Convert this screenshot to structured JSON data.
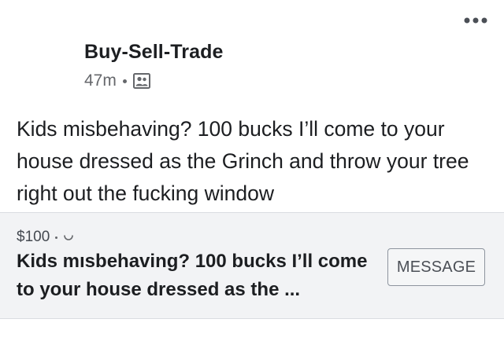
{
  "post": {
    "group_name": "Buy-Sell-Trade",
    "timestamp": "47m",
    "audience_icon": "group-members-icon",
    "more_icon": "more-options-icon",
    "text": "Kids misbehaving? 100 bucks I’ll come to your house dressed as the Grinch and throw your tree right out the fucking window"
  },
  "listing": {
    "price": "$100",
    "location_status_icon": "loading-icon",
    "title": "Kids mısbehaving? 100 bucks I’ll come to your house dressed as the ...",
    "message_label": "MESSAGE"
  },
  "colors": {
    "text_primary": "#1c1e21",
    "text_secondary": "#65676b",
    "listing_background": "#f2f3f5",
    "button_border": "#8d949e"
  }
}
